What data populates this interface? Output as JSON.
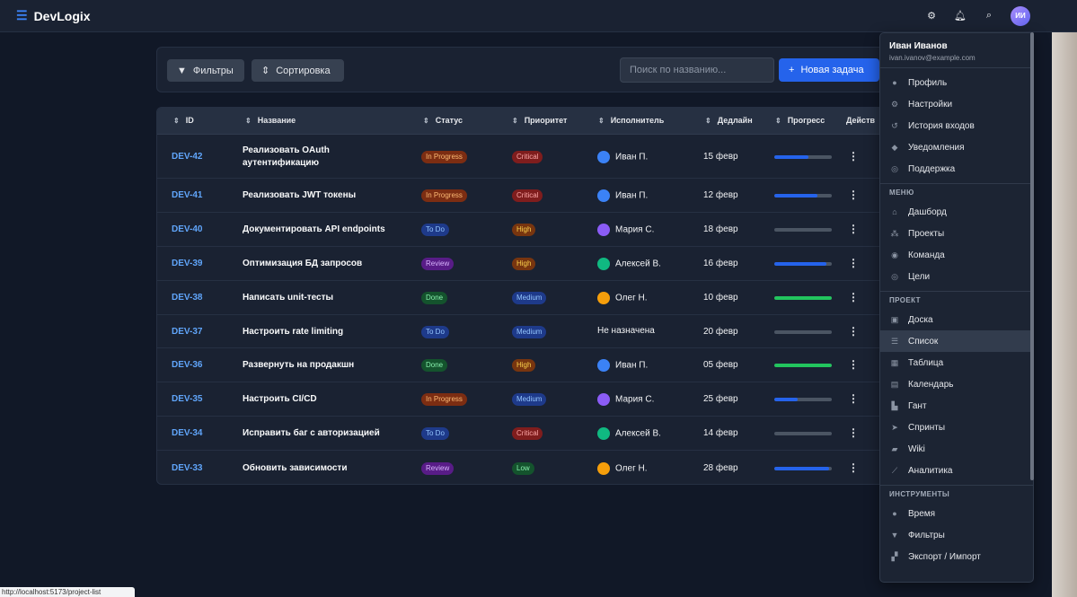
{
  "app": {
    "name": "DevLogix"
  },
  "topbar": {
    "avatar_initials": "ИИ",
    "icons": [
      "list-icon",
      "gear-icon",
      "bell-icon",
      "search-icon"
    ]
  },
  "toolbar": {
    "filters_label": "Фильтры",
    "sort_label": "Сортировка",
    "search_placeholder": "Поиск по названию...",
    "new_task_label": "Новая задача"
  },
  "table": {
    "columns": [
      "ID",
      "Название",
      "Статус",
      "Приоритет",
      "Исполнитель",
      "Дедлайн",
      "Прогресс",
      "Действ"
    ],
    "rows": [
      {
        "id": "DEV-42",
        "name_lines": [
          "Реализовать OAuth",
          "аутентификацию"
        ],
        "status": "In Progress",
        "priority": "Critical",
        "assignee": "Иван П.",
        "deadline": "15 февр",
        "progress": 60
      },
      {
        "id": "DEV-41",
        "name_lines": [
          "Реализовать JWT токены"
        ],
        "status": "In Progress",
        "priority": "Critical",
        "assignee": "Иван П.",
        "deadline": "12 февр",
        "progress": 75
      },
      {
        "id": "DEV-40",
        "name_lines": [
          "Документировать API endpoints"
        ],
        "status": "To Do",
        "priority": "High",
        "assignee": "Мария С.",
        "deadline": "18 февр",
        "progress": 0
      },
      {
        "id": "DEV-39",
        "name_lines": [
          "Оптимизация БД запросов"
        ],
        "status": "Review",
        "priority": "High",
        "assignee": "Алексей В.",
        "deadline": "16 февр",
        "progress": 90
      },
      {
        "id": "DEV-38",
        "name_lines": [
          "Написать unit-тесты"
        ],
        "status": "Done",
        "priority": "Medium",
        "assignee": "Олег Н.",
        "deadline": "10 февр",
        "progress": 100
      },
      {
        "id": "DEV-37",
        "name_lines": [
          "Настроить rate limiting"
        ],
        "status": "To Do",
        "priority": "Medium",
        "assignee": "Не назначена",
        "deadline": "20 февр",
        "progress": 0
      },
      {
        "id": "DEV-36",
        "name_lines": [
          "Развернуть на продакшн"
        ],
        "status": "Done",
        "priority": "High",
        "assignee": "Иван П.",
        "deadline": "05 февр",
        "progress": 100
      },
      {
        "id": "DEV-35",
        "name_lines": [
          "Настроить CI/CD"
        ],
        "status": "In Progress",
        "priority": "Medium",
        "assignee": "Мария С.",
        "deadline": "25 февр",
        "progress": 40
      },
      {
        "id": "DEV-34",
        "name_lines": [
          "Исправить баг с авторизацией"
        ],
        "status": "To Do",
        "priority": "Critical",
        "assignee": "Алексей В.",
        "deadline": "14 февр",
        "progress": 0
      },
      {
        "id": "DEV-33",
        "name_lines": [
          "Обновить зависимости"
        ],
        "status": "Review",
        "priority": "Low",
        "assignee": "Олег Н.",
        "deadline": "28 февр",
        "progress": 95
      }
    ]
  },
  "menu": {
    "user_name": "Иван Иванов",
    "user_email": "ivan.ivanov@example.com",
    "user_items": [
      {
        "icon": "user-icon",
        "label": "Профиль"
      },
      {
        "icon": "gear-icon",
        "label": "Настройки"
      },
      {
        "icon": "history-icon",
        "label": "История входов"
      },
      {
        "icon": "bell-icon",
        "label": "Уведомления"
      },
      {
        "icon": "support-icon",
        "label": "Поддержка"
      }
    ],
    "sections": [
      {
        "title": "МЕНЮ",
        "items": [
          {
            "icon": "home-icon",
            "label": "Дашборд"
          },
          {
            "icon": "projects-icon",
            "label": "Проекты"
          },
          {
            "icon": "team-icon",
            "label": "Команда"
          },
          {
            "icon": "target-icon",
            "label": "Цели"
          }
        ]
      },
      {
        "title": "ПРОЕКТ",
        "items": [
          {
            "icon": "board-icon",
            "label": "Доска"
          },
          {
            "icon": "list-icon",
            "label": "Список"
          },
          {
            "icon": "table-icon",
            "label": "Таблица"
          },
          {
            "icon": "calendar-icon",
            "label": "Календарь"
          },
          {
            "icon": "gantt-icon",
            "label": "Гант"
          },
          {
            "icon": "rocket-icon",
            "label": "Спринты"
          },
          {
            "icon": "wiki-icon",
            "label": "Wiki"
          },
          {
            "icon": "chart-icon",
            "label": "Аналитика"
          }
        ]
      },
      {
        "title": "ИНСТРУМЕНТЫ",
        "items": [
          {
            "icon": "clock-icon",
            "label": "Время"
          },
          {
            "icon": "filter-icon",
            "label": "Фильтры"
          },
          {
            "icon": "export-icon",
            "label": "Экспорт / Импорт"
          }
        ]
      }
    ],
    "active_label": "Список"
  },
  "statusbar": {
    "url": "http://localhost:5173/project-list"
  },
  "colors": {
    "accent": "#2563eb",
    "status_in_progress": "#7c2d12",
    "status_to_do": "#1e3a8a",
    "status_review": "#581c87",
    "status_done": "#14532d",
    "priority_critical": "#7f1d1d",
    "priority_high": "#78350f",
    "priority_medium": "#1e3a8a",
    "priority_low": "#14532d"
  }
}
